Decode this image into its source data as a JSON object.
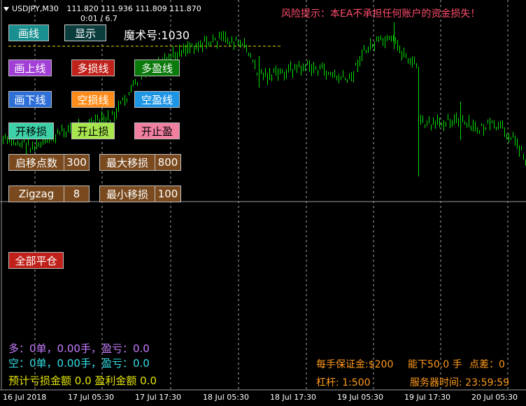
{
  "header": {
    "symbol": "USDJPY,M30",
    "ohlc": "111.820 111.936 111.809 111.870",
    "spread_info": "0:01 / 6.7",
    "risk_warning": "风险提示：本EA不承担任何账户的资金损失！"
  },
  "panel": {
    "draw_line": "画线",
    "show": "显示",
    "magic_label": "魔术号:1030",
    "draw_upper": "画上线",
    "long_sl": "多损线",
    "long_tp": "多盈线",
    "draw_lower": "画下线",
    "short_sl": "空损线",
    "short_tp": "空盈线",
    "open_trailing": "开移损",
    "open_sl": "开止损",
    "open_tp": "开止盈",
    "trail_start_label": "启移点数",
    "trail_start_value": "300",
    "max_trail_label": "最大移损",
    "max_trail_value": "800",
    "zigzag_label": "Zigzag",
    "zigzag_value": "8",
    "min_trail_label": "最小移损",
    "min_trail_value": "100",
    "close_all": "全部平仓"
  },
  "stats": {
    "long_line": "多：0单，0.00手，盈亏：0.0",
    "short_line": "空：0单，0.00手，盈亏：0.0",
    "estimate_line": "预计亏损金额 0.0 盈利金额 0.0",
    "margin": "每手保证金:$200",
    "can_open": "能下50.0 手",
    "spread": "点差：0",
    "leverage": "杠杆: 1:500",
    "server_time": "服务器时间:  23:59:59"
  },
  "colors": {
    "candle": "#00e000",
    "grid": "#cccccc",
    "magic_line": "#e0e000",
    "warning": "#ff4d6d",
    "long_text": "#c77dff",
    "short_text": "#33e0e6",
    "estimate_text": "#e6e600",
    "info_text": "#ff9a1a"
  },
  "xaxis": {
    "labels": [
      "16 Jul 2018",
      "17 Jul 05:30",
      "17 Jul 17:30",
      "18 Jul 05:30",
      "18 Jul 17:30",
      "19 Jul 05:30",
      "19 Jul 17:30",
      "20 Jul 05:30"
    ]
  }
}
